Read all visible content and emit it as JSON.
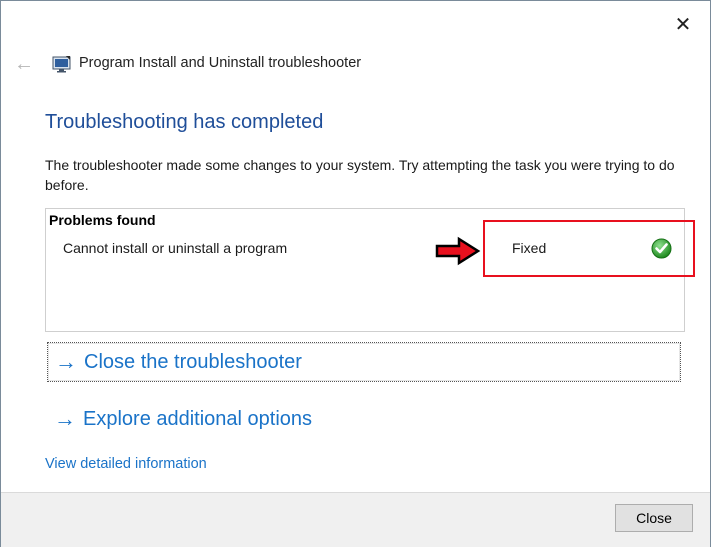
{
  "window": {
    "title": "Program Install and Uninstall troubleshooter",
    "close_glyph": "✕",
    "back_glyph": "←"
  },
  "main": {
    "heading": "Troubleshooting has completed",
    "description": "The troubleshooter made some changes to your system. Try attempting the task you were trying to do before.",
    "problems": {
      "header": "Problems found",
      "items": [
        {
          "name": "Cannot install or uninstall a program",
          "status": "Fixed",
          "status_icon": "green-check-icon"
        }
      ]
    },
    "options": [
      {
        "label": "Close the troubleshooter",
        "icon": "arrow-right-icon"
      },
      {
        "label": "Explore additional options",
        "icon": "arrow-right-icon"
      }
    ],
    "details_link": "View detailed information"
  },
  "footer": {
    "close_label": "Close"
  },
  "colors": {
    "heading": "#1f4e99",
    "link": "#1a73c8",
    "highlight": "#e8101e",
    "check": "#2e9e2e"
  }
}
